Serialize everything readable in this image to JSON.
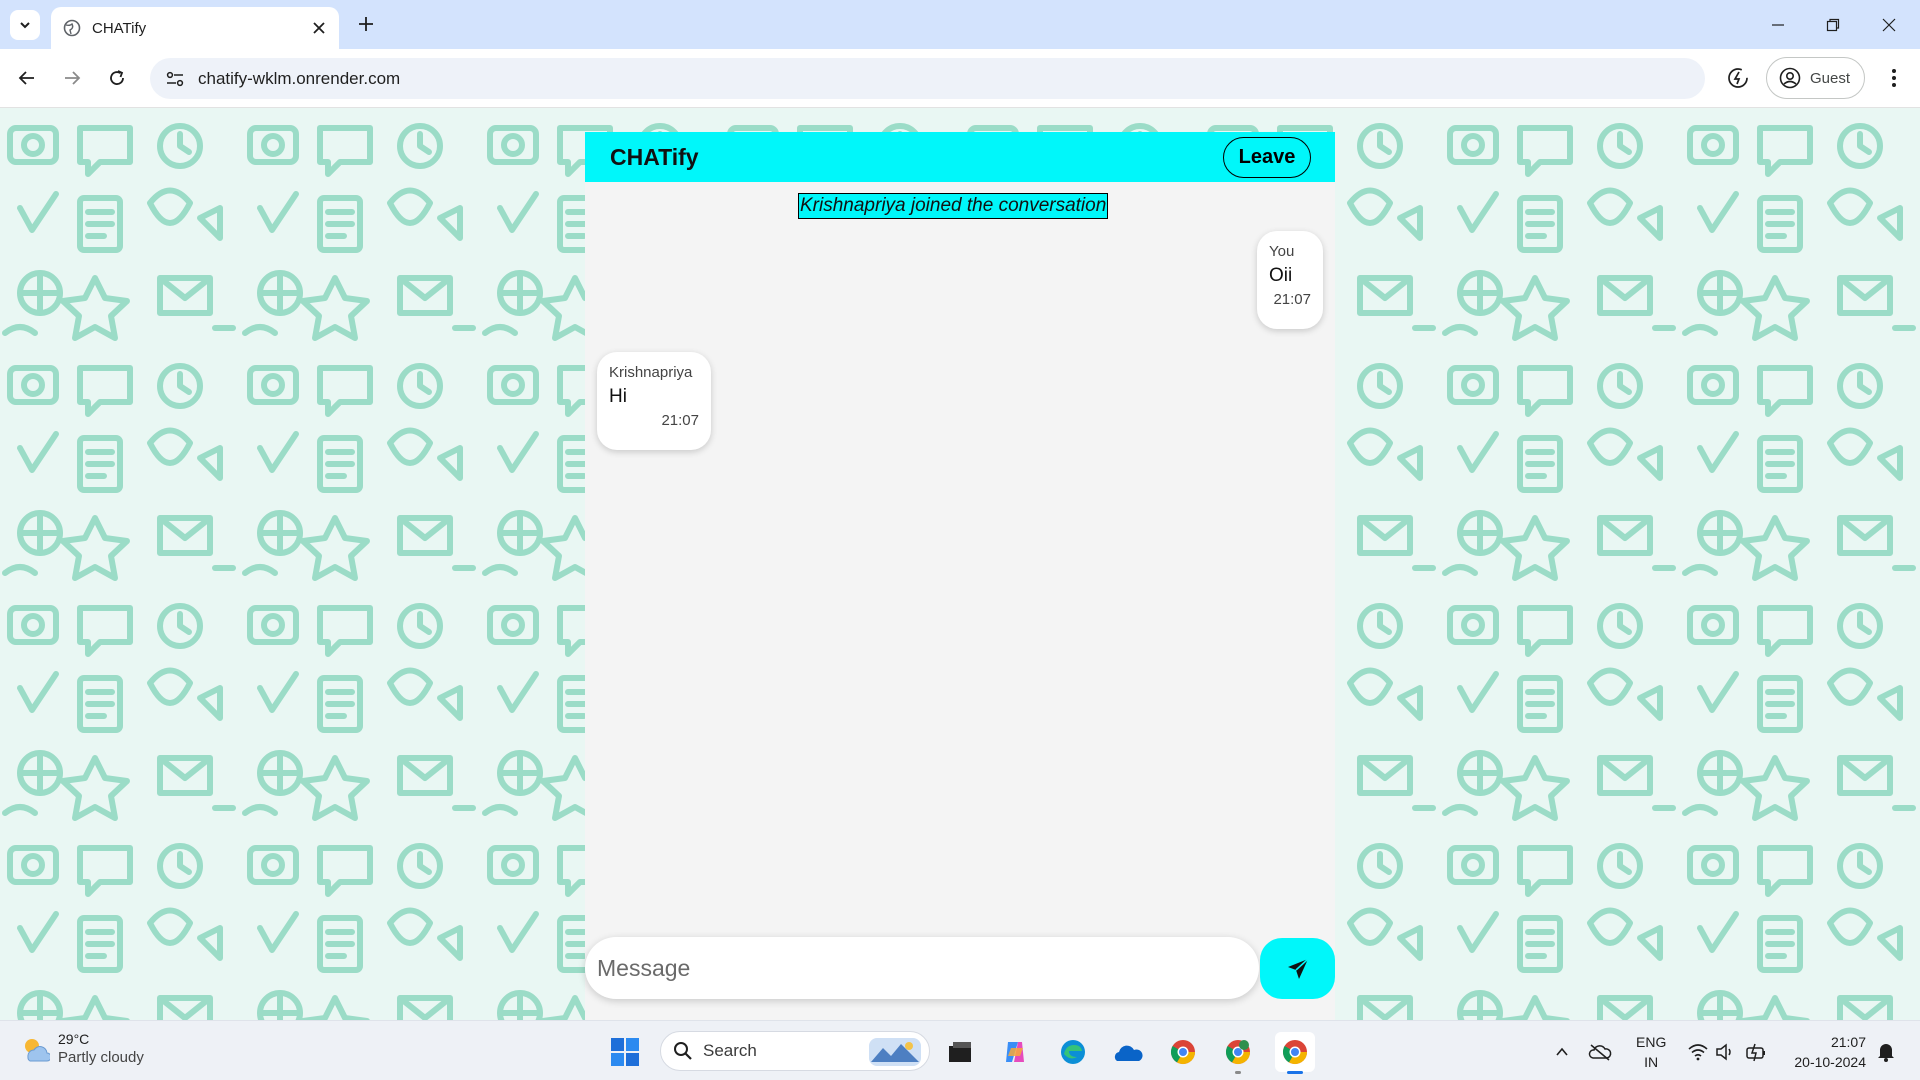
{
  "browser": {
    "tab_title": "CHATify",
    "url": "chatify-wklm.onrender.com",
    "profile_label": "Guest"
  },
  "chat": {
    "app_title": "CHATify",
    "leave_label": "Leave",
    "system_message": "Krishnapriya joined the conversation",
    "messages": [
      {
        "sender": "You",
        "text": "Oii",
        "time": "21:07",
        "side": "right"
      },
      {
        "sender": "Krishnapriya",
        "text": "Hi",
        "time": "21:07",
        "side": "left"
      }
    ],
    "input_placeholder": "Message",
    "accent_color": "#00f7fa",
    "background_pattern_color": "#9bdcc7"
  },
  "taskbar": {
    "weather_temp": "29°C",
    "weather_condition": "Partly cloudy",
    "search_placeholder": "Search",
    "language_line1": "ENG",
    "language_line2": "IN",
    "time": "21:07",
    "date": "20-10-2024",
    "apps": [
      "windows-start-icon",
      "file-explorer-icon",
      "copilot-icon",
      "edge-icon",
      "onedrive-icon",
      "chrome-icon",
      "chrome-profile-icon",
      "chrome-active-icon"
    ]
  }
}
